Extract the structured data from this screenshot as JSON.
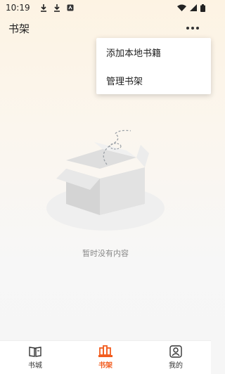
{
  "status_bar": {
    "time": "10:19",
    "left_icons": [
      "download-icon",
      "download-icon",
      "app-badge-icon"
    ],
    "right_icons": [
      "wifi-icon",
      "signal-icon",
      "battery-icon"
    ]
  },
  "app_bar": {
    "title": "书架",
    "more_icon": "more-dots-icon"
  },
  "menu": {
    "items": [
      {
        "label": "添加本地书籍"
      },
      {
        "label": "管理书架"
      }
    ]
  },
  "empty_state": {
    "illustration": "empty-box-icon",
    "text": "暂时没有内容"
  },
  "bottom_nav": {
    "active_color": "#f25c1e",
    "items": [
      {
        "label": "书城",
        "icon": "book-icon",
        "active": false
      },
      {
        "label": "书架",
        "icon": "bookshelf-icon",
        "active": true
      },
      {
        "label": "我的",
        "icon": "user-icon",
        "active": false
      }
    ]
  }
}
